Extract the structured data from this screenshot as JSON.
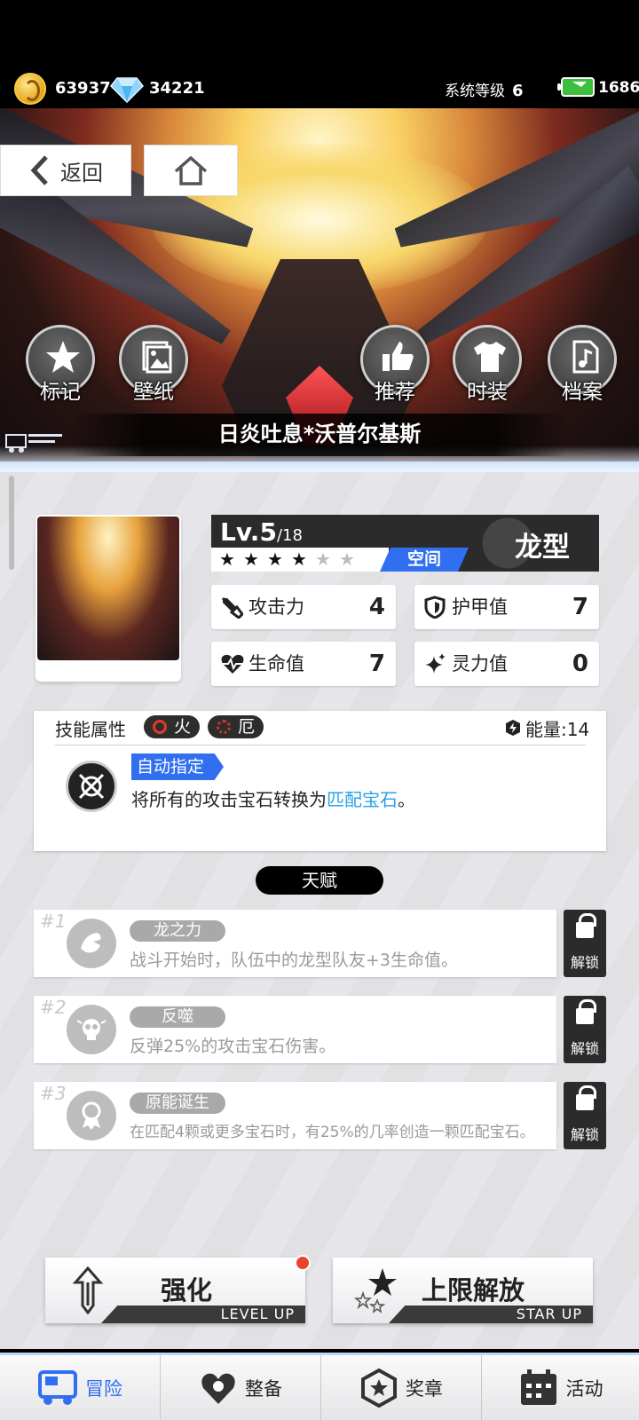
{
  "status": {
    "gold": "63937",
    "diamonds": "34221",
    "system_level_label": "系统等级",
    "system_level": "6",
    "energy": "1686"
  },
  "nav": {
    "back_label": "返回"
  },
  "hero_actions": [
    {
      "label": "标记",
      "icon": "star-icon"
    },
    {
      "label": "壁纸",
      "icon": "image-icon"
    },
    {
      "label": "推荐",
      "icon": "thumbs-up-icon"
    },
    {
      "label": "时装",
      "icon": "shirt-icon"
    },
    {
      "label": "档案",
      "icon": "music-file-icon"
    }
  ],
  "card": {
    "name": "日炎吐息*沃普尔基斯",
    "level": "Lv.5",
    "level_max": "/18",
    "stars_filled": 4,
    "stars_total": 6,
    "element": "空间",
    "type": "龙型",
    "stats": {
      "attack_label": "攻击力",
      "attack": "4",
      "armor_label": "护甲值",
      "armor": "7",
      "hp_label": "生命值",
      "hp": "7",
      "spirit_label": "灵力值",
      "spirit": "0"
    }
  },
  "skill": {
    "header": "技能属性",
    "tags": [
      "火",
      "厄"
    ],
    "energy": "能量:14",
    "name": "自动指定",
    "desc_prefix": "将所有的攻击宝石转换为",
    "desc_highlight": "匹配宝石",
    "desc_suffix": "。"
  },
  "talent_header": "天赋",
  "talents": [
    {
      "num": "#1",
      "name": "龙之力",
      "desc": "战斗开始时，队伍中的龙型队友+3生命值。",
      "lock": "解锁"
    },
    {
      "num": "#2",
      "name": "反噬",
      "desc": "反弹25%的攻击宝石伤害。",
      "lock": "解锁"
    },
    {
      "num": "#3",
      "name": "原能诞生",
      "desc": "在匹配4颗或更多宝石时，有25%的几率创造一颗匹配宝石。",
      "lock": "解锁"
    }
  ],
  "buttons": {
    "upgrade": "强化",
    "upgrade_sub": "LEVEL UP",
    "ascend": "上限解放",
    "ascend_sub": "STAR UP"
  },
  "tabs": [
    "冒险",
    "整备",
    "奖章",
    "活动"
  ],
  "colors": {
    "accent": "#2f6ff0",
    "highlight": "#2aa0e6",
    "badge": "#e9442f"
  }
}
